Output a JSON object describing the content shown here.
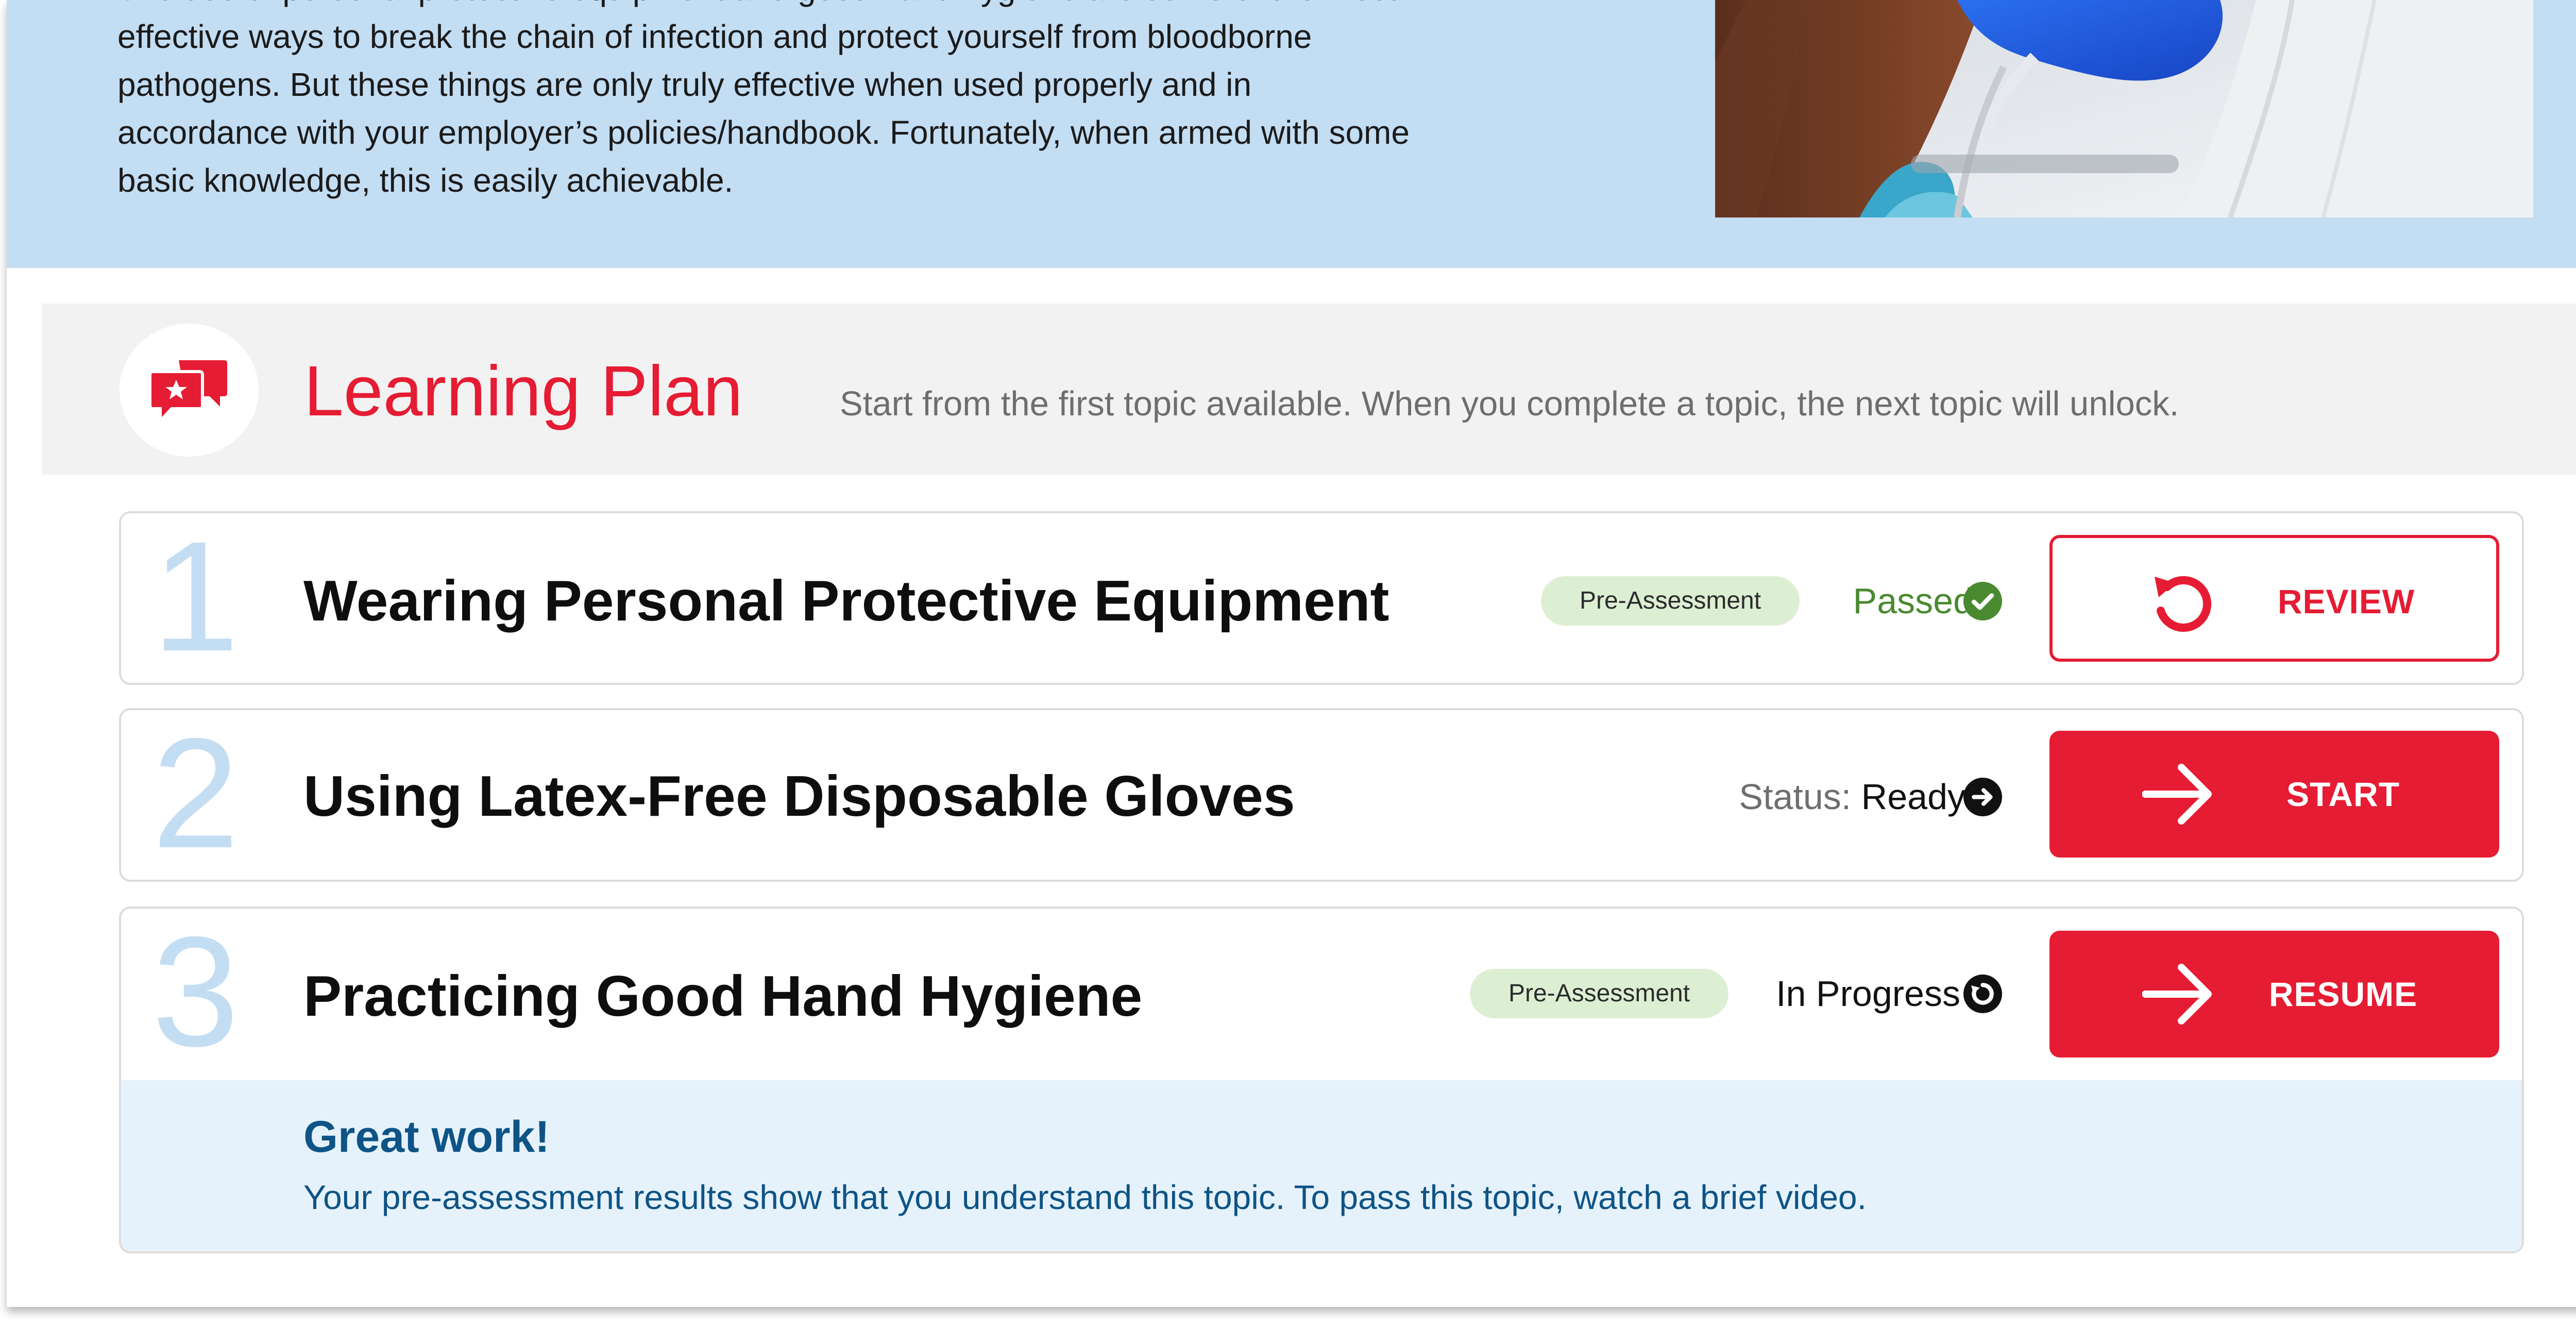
{
  "hero": {
    "text_lines": [
      "The use of personal protective equipment and good hand hygiene are some of the most",
      "effective ways to break the chain of infection and protect yourself from bloodborne",
      "pathogens. But these things are only truly effective when used properly and in",
      "accordance with your employer’s policies/handbook. Fortunately, when armed with some",
      "basic knowledge, this is easily achievable."
    ],
    "image_icon": "photo-gloved-hands-dental-procedure"
  },
  "learning_plan": {
    "icon": "chat-bubbles-star-icon",
    "title": "Learning Plan",
    "instructions": "Start from the first topic available. When you complete a topic, the next topic will unlock."
  },
  "topics": [
    {
      "number": "1",
      "title": "Wearing Personal Protective Equipment",
      "badge": "Pre-Assessment",
      "status_prefix": "",
      "status": "Passed",
      "status_color": "#4a8a2f",
      "status_icon": "check-circle-icon",
      "button_label": "REVIEW",
      "button_icon": "refresh-icon",
      "button_style": "outline"
    },
    {
      "number": "2",
      "title": "Using Latex-Free Disposable Gloves",
      "badge": "",
      "status_prefix": "Status:",
      "status": "Ready",
      "status_color": "#111111",
      "status_icon": "arrow-circle-icon",
      "button_label": "START",
      "button_icon": "arrow-right-icon",
      "button_style": "solid"
    },
    {
      "number": "3",
      "title": "Practicing Good Hand Hygiene",
      "badge": "Pre-Assessment",
      "status_prefix": "",
      "status": "In Progress",
      "status_color": "#111111",
      "status_icon": "progress-circle-icon",
      "button_label": "RESUME",
      "button_icon": "arrow-right-icon",
      "button_style": "solid",
      "feedback": {
        "heading": "Great work!",
        "body": "Your pre-assessment results show that you understand this topic. To pass this topic, watch a brief video."
      }
    }
  ],
  "colors": {
    "accent_red": "#e51c33",
    "hero_blue": "#c3ddf3",
    "badge_green": "#ddefd3",
    "feedback_blue": "#0e5486"
  }
}
